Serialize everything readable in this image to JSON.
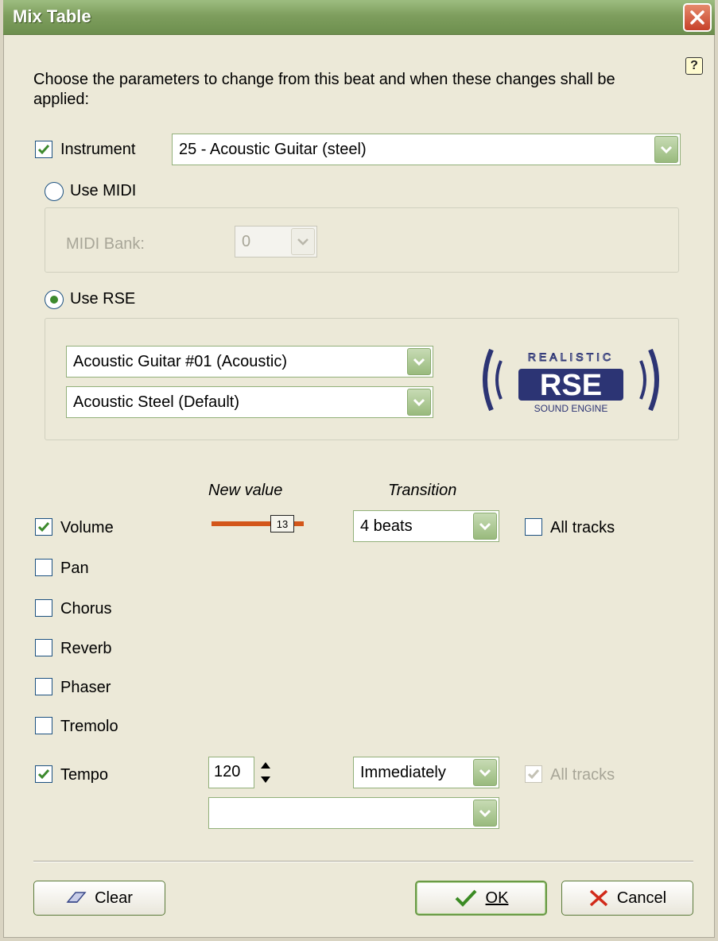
{
  "window": {
    "title": "Mix Table",
    "help_icon": "help-icon",
    "close_icon": "close-icon"
  },
  "description": "Choose the parameters to change from this beat and when these changes shall be applied:",
  "instrument": {
    "label": "Instrument",
    "checked": true,
    "selected": "25 - Acoustic Guitar (steel)"
  },
  "midi": {
    "radio_label": "Use MIDI",
    "selected": false,
    "bank_label": "MIDI Bank:",
    "bank_value": "0"
  },
  "rse": {
    "radio_label": "Use RSE",
    "selected": true,
    "instrument": "Acoustic Guitar #01 (Acoustic)",
    "soundbank": "Acoustic Steel (Default)",
    "logo_top": "REALISTIC",
    "logo_main": "RSE",
    "logo_bottom": "SOUND ENGINE"
  },
  "columns": {
    "new_value": "New value",
    "transition": "Transition"
  },
  "params": {
    "volume": {
      "label": "Volume",
      "checked": true,
      "value": "13",
      "transition": "4 beats",
      "all_tracks_label": "All tracks",
      "all_tracks": false
    },
    "pan": {
      "label": "Pan",
      "checked": false
    },
    "chorus": {
      "label": "Chorus",
      "checked": false
    },
    "reverb": {
      "label": "Reverb",
      "checked": false
    },
    "phaser": {
      "label": "Phaser",
      "checked": false
    },
    "tremolo": {
      "label": "Tremolo",
      "checked": false
    },
    "tempo": {
      "label": "Tempo",
      "checked": true,
      "value": "120",
      "transition": "Immediately",
      "all_tracks_label": "All tracks",
      "all_tracks": true,
      "extra": ""
    }
  },
  "buttons": {
    "clear": "Clear",
    "ok": "OK",
    "cancel": "Cancel"
  },
  "colors": {
    "title_bar": "#7e9e5e",
    "dialog_bg": "#ece9d8",
    "slider": "#d3561a",
    "check": "#3d8a2e"
  }
}
